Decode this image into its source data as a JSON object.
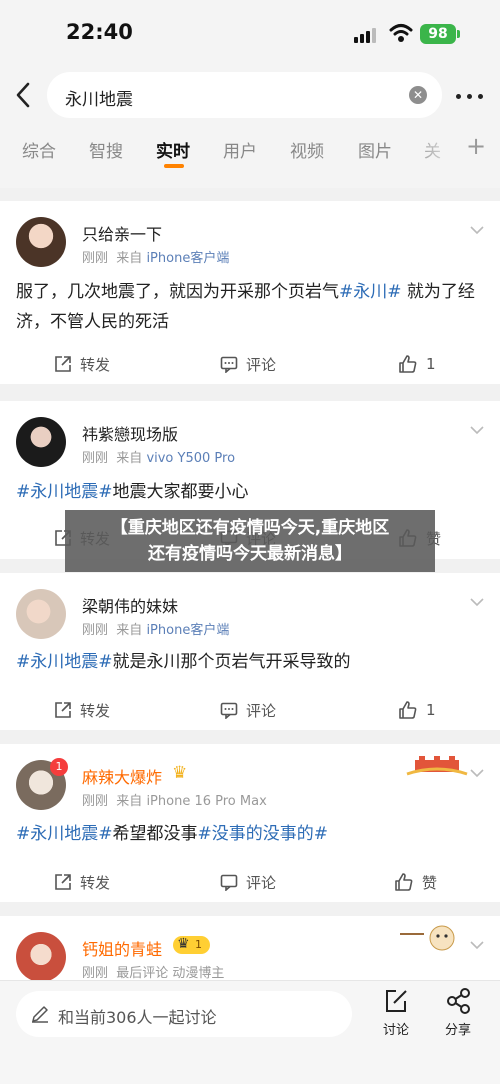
{
  "status": {
    "time": "22:40",
    "battery": "98"
  },
  "search": {
    "query": "永川地震",
    "clear_icon": "clear-icon",
    "more_icon": "more-icon"
  },
  "tabs": [
    {
      "label": "综合"
    },
    {
      "label": "智搜"
    },
    {
      "label": "实时"
    },
    {
      "label": "用户"
    },
    {
      "label": "视频"
    },
    {
      "label": "图片"
    },
    {
      "label": "关"
    }
  ],
  "tabs_plus": "+",
  "accent_color": "#ff8200",
  "link_color": "#2d6cb6",
  "posts": [
    {
      "name": "只给亲一下",
      "time": "刚刚",
      "from": "来自",
      "source": "iPhone客户端",
      "text_parts": [
        "服了，几次地震了，就因为开采那个页岩气",
        "#永川#",
        " 就为了经济，不管人民的死活"
      ],
      "repost": "转发",
      "comment": "评论",
      "like": "1"
    },
    {
      "name": "祎紫戀现场版",
      "time": "刚刚",
      "from": "来自",
      "source": "vivo Y500 Pro",
      "text_parts": [
        "#永川地震#",
        "地震大家都要小心"
      ],
      "repost": "转发",
      "comment": "评论",
      "like": "赞"
    },
    {
      "name": "梁朝伟的妹妹",
      "time": "刚刚",
      "from": "来自",
      "source": "iPhone客户端",
      "text_parts": [
        "#永川地震#",
        "就是永川那个页岩气开采导致的"
      ],
      "repost": "转发",
      "comment": "评论",
      "like": "1"
    },
    {
      "name": "麻辣大爆炸",
      "time": "刚刚",
      "from": "来自",
      "source": "iPhone 16 Pro Max",
      "badge_count": "1",
      "text_parts": [
        "#永川地震#",
        "希望都没事",
        "#没事的没事的#"
      ],
      "repost": "转发",
      "comment": "评论",
      "like": "赞"
    },
    {
      "name": "钙姐的青蛙",
      "time": "刚刚",
      "meta_extra": "最后评论  动漫博主",
      "level": "1"
    }
  ],
  "banner": {
    "line1": "【重庆地区还有疫情吗今天,重庆地区",
    "line2": "还有疫情吗今天最新消息】"
  },
  "bottom": {
    "discuss": "和当前306人一起讨论",
    "comment": "讨论",
    "share": "分享"
  }
}
